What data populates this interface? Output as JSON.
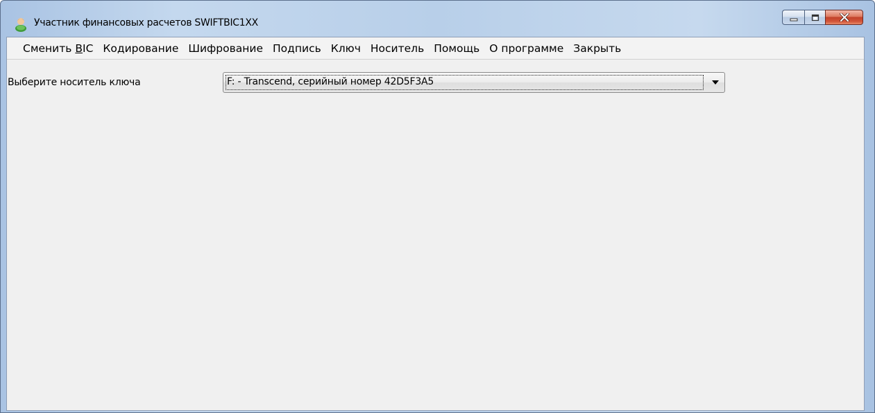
{
  "window": {
    "title": "Участник финансовых расчетов SWIFTBIC1XX"
  },
  "menu": {
    "change_bic_prefix": "Сменить ",
    "change_bic_underlined": "B",
    "change_bic_suffix": "IC",
    "encoding": "Кодирование",
    "encryption": "Шифрование",
    "signature": "Подпись",
    "key": "Ключ",
    "carrier": "Носитель",
    "help": "Помощь",
    "about": "О программе",
    "close": "Закрыть"
  },
  "key_carrier": {
    "label": "Выберите носитель ключа",
    "selected": "F: - Transcend, серийный номер 42D5F3A5"
  },
  "icons": {
    "app": "user-icon",
    "minimize": "minimize-icon",
    "maximize": "maximize-icon",
    "close": "close-icon",
    "dropdown": "chevron-down-icon"
  }
}
